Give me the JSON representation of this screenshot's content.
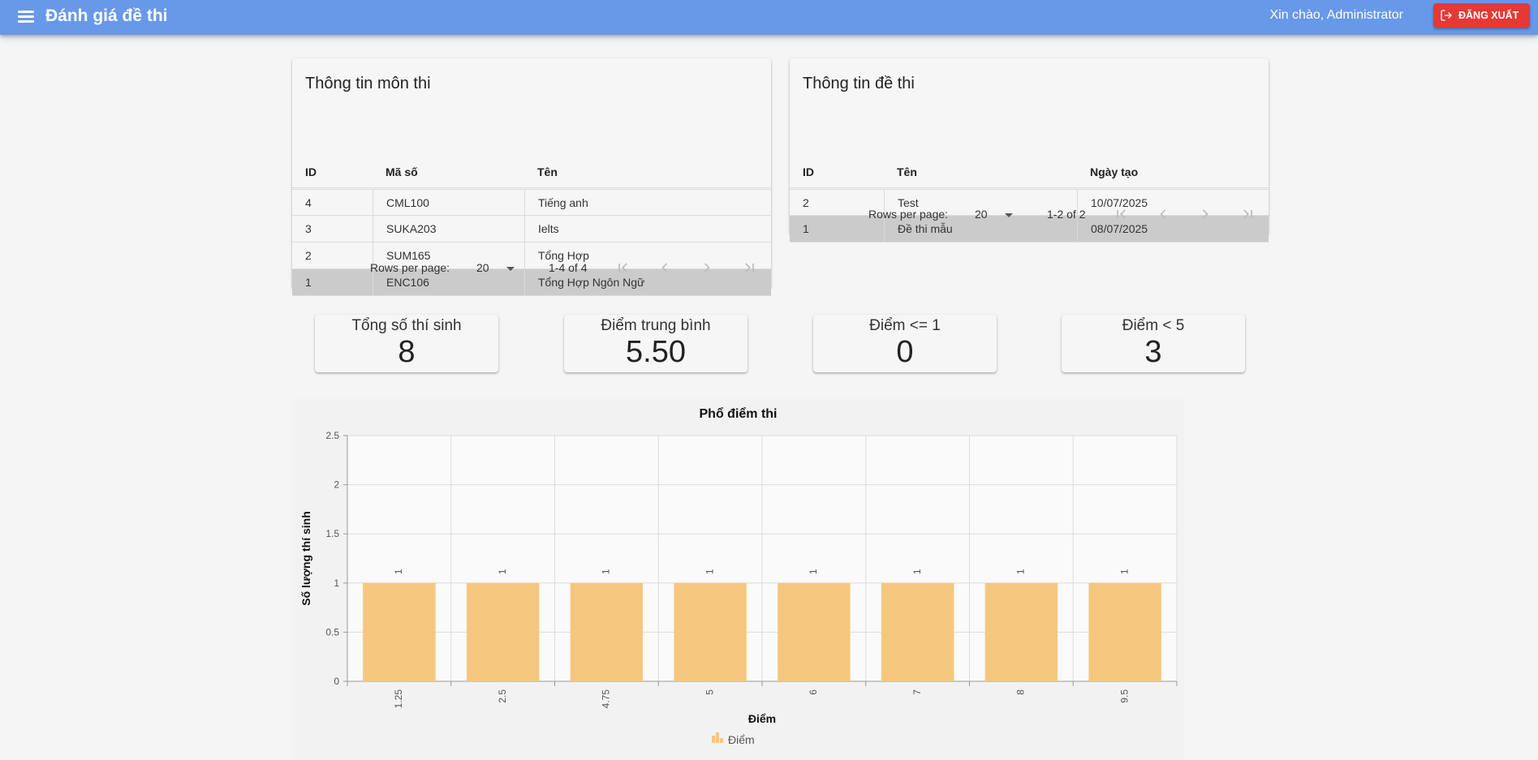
{
  "header": {
    "title": "Đánh giá đề thi",
    "greeting": "Xin chào, Administrator",
    "logout_label": "ĐĂNG XUẤT"
  },
  "subjects": {
    "title": "Thông tin môn thi",
    "columns": [
      "ID",
      "Mã số",
      "Tên"
    ],
    "rows": [
      {
        "id": "4",
        "code": "CML100",
        "name": "Tiếng anh"
      },
      {
        "id": "3",
        "code": "SUKA203",
        "name": "Ielts"
      },
      {
        "id": "2",
        "code": "SUM165",
        "name": "Tổng Hợp"
      },
      {
        "id": "1",
        "code": "ENC106",
        "name": "Tổng Hợp Ngôn Ngữ"
      }
    ],
    "selected_row": 3,
    "rows_per_page_label": "Rows per page:",
    "rows_per_page": "20",
    "range": "1-4 of 4"
  },
  "exams": {
    "title": "Thông tin đề thi",
    "columns": [
      "ID",
      "Tên",
      "Ngày tạo"
    ],
    "rows": [
      {
        "id": "2",
        "name": "Test",
        "date": "10/07/2025"
      },
      {
        "id": "1",
        "name": "Đề thi mẫu",
        "date": "08/07/2025"
      }
    ],
    "selected_row": 1,
    "rows_per_page_label": "Rows per page:",
    "rows_per_page": "20",
    "range": "1-2 of 2"
  },
  "stats": [
    {
      "label": "Tổng số thí sinh",
      "value": "8"
    },
    {
      "label": "Điểm trung bình",
      "value": "5.50"
    },
    {
      "label": "Điểm <= 1",
      "value": "0"
    },
    {
      "label": "Điểm < 5",
      "value": "3"
    }
  ],
  "chart_data": {
    "type": "bar",
    "title": "Phổ điểm thi",
    "xlabel": "Điểm",
    "ylabel": "Số lượng thí sinh",
    "categories": [
      "1.25",
      "2.5",
      "4.75",
      "5",
      "6",
      "7",
      "8",
      "9.5"
    ],
    "series": [
      {
        "name": "Điểm",
        "values": [
          1,
          1,
          1,
          1,
          1,
          1,
          1,
          1
        ]
      }
    ],
    "ylim": [
      0,
      2.5
    ],
    "yticks": [
      "0",
      "0.5",
      "1",
      "1.5",
      "2",
      "2.5"
    ],
    "data_labels": [
      "1",
      "1",
      "1",
      "1",
      "1",
      "1",
      "1",
      "1"
    ],
    "grid": true,
    "legend": "bottom",
    "bar_color": "#f5c77e"
  },
  "colors": {
    "appbar": "#6898e8",
    "logout": "#e53935",
    "selected_row": "#cbcbcb"
  }
}
